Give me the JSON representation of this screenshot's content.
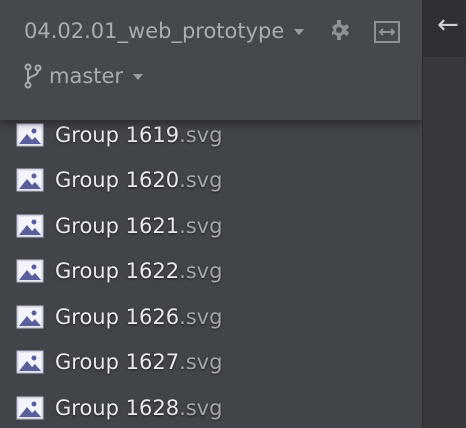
{
  "project": {
    "name": "04.02.01_web_prototype",
    "branch": "master"
  },
  "toolbar": {
    "back_symbol": "←"
  },
  "files": [
    {
      "name": "Group 1619",
      "ext": ".svg",
      "icon": "image-icon"
    },
    {
      "name": "Group 1620",
      "ext": ".svg",
      "icon": "image-icon"
    },
    {
      "name": "Group 1621",
      "ext": ".svg",
      "icon": "image-icon"
    },
    {
      "name": "Group 1622",
      "ext": ".svg",
      "icon": "image-icon"
    },
    {
      "name": "Group 1626",
      "ext": ".svg",
      "icon": "image-icon"
    },
    {
      "name": "Group 1627",
      "ext": ".svg",
      "icon": "image-icon"
    },
    {
      "name": "Group 1628",
      "ext": ".svg",
      "icon": "image-icon"
    }
  ],
  "colors": {
    "sidebar_bg": "#414449",
    "header_bg": "#45484d",
    "file_text": "#e8e9ec",
    "muted_text": "#a9acb2",
    "editor_bg": "#36383c"
  }
}
